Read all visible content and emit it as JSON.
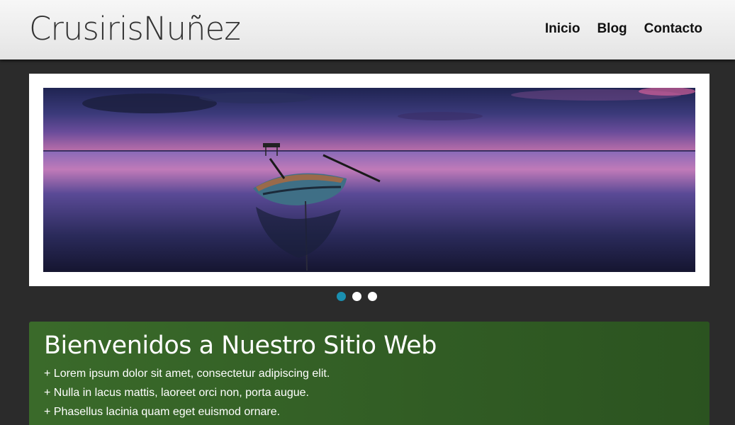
{
  "header": {
    "logo_text": "CrusirisNuñez",
    "nav": [
      "Inicio",
      "Blog",
      "Contacto"
    ]
  },
  "slider": {
    "slide_count": 3,
    "active_index": 0
  },
  "welcome": {
    "title": "Bienvenidos a Nuestro Sitio Web",
    "items": [
      "+ Lorem ipsum dolor sit amet, consectetur adipiscing elit.",
      "+ Nulla in lacus mattis, laoreet orci non, porta augue.",
      "+ Phasellus lacinia quam eget euismod ornare."
    ]
  },
  "colors": {
    "header_bg": "#eeeeee",
    "page_bg": "#2b2b2b",
    "welcome_bg": "#346024",
    "dot_active": "#1a8fb0"
  }
}
